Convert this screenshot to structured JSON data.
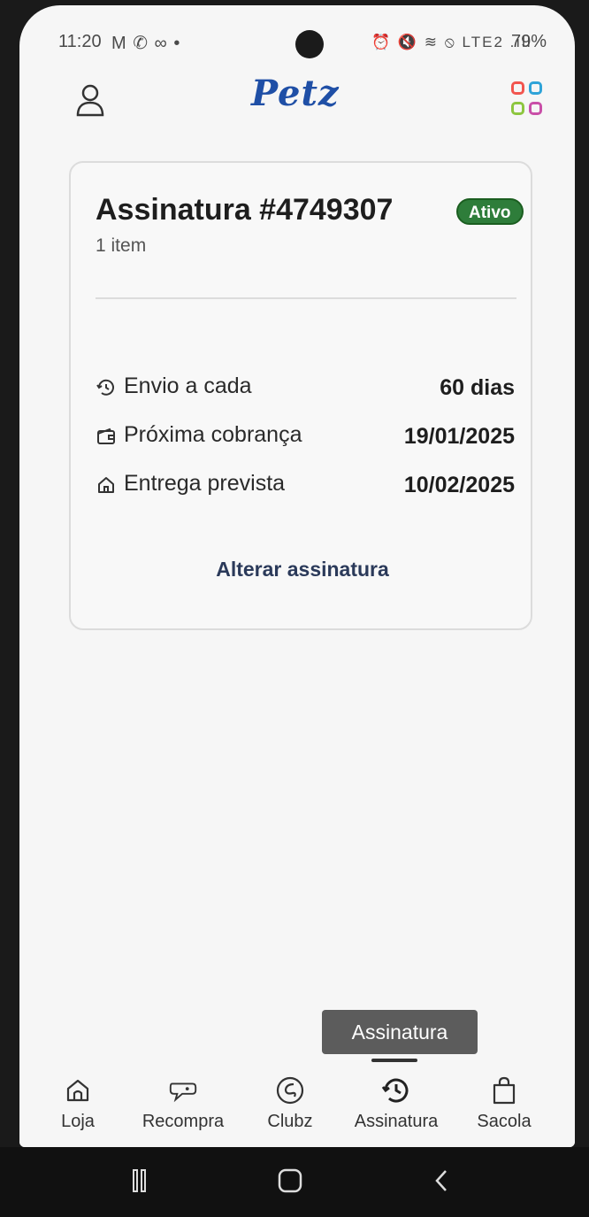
{
  "status_bar": {
    "time": "11:20",
    "left_icons": "M ✆ ∞ •",
    "right_icons": "⏰ 🔇 ≋ ⦸ LTE2 .ıll",
    "battery": "79%"
  },
  "header": {
    "logo": "Petz",
    "profile_icon": "person-icon",
    "apps_icon": "apps-grid-icon",
    "apps_colors": [
      "#f2554f",
      "#2fa3d8",
      "#8dc63f",
      "#c94fa8"
    ]
  },
  "subscription": {
    "title": "Assinatura #4749307",
    "status": "Ativo",
    "item_count": "1 item",
    "rows": [
      {
        "icon": "repeat-clock-icon",
        "label": "Envio a cada",
        "value": "60 dias"
      },
      {
        "icon": "wallet-icon",
        "label": "Próxima cobrança",
        "value": "19/01/2025"
      },
      {
        "icon": "home-icon",
        "label": "Entrega prevista",
        "value": "10/02/2025"
      }
    ],
    "action": "Alterar assinatura"
  },
  "tooltip": "Assinatura",
  "bottom_nav": [
    {
      "label": "Loja",
      "icon": "home-icon"
    },
    {
      "label": "Recompra",
      "icon": "repurchase-icon"
    },
    {
      "label": "Clubz",
      "icon": "clubz-icon"
    },
    {
      "label": "Assinatura",
      "icon": "subscription-icon",
      "active": true
    },
    {
      "label": "Sacola",
      "icon": "shopping-bag-icon"
    }
  ],
  "system_nav": [
    "recents-icon",
    "home-icon",
    "back-icon"
  ],
  "colors": {
    "brand_blue": "#1f4fa6",
    "active_badge": "#2e7d3a"
  }
}
